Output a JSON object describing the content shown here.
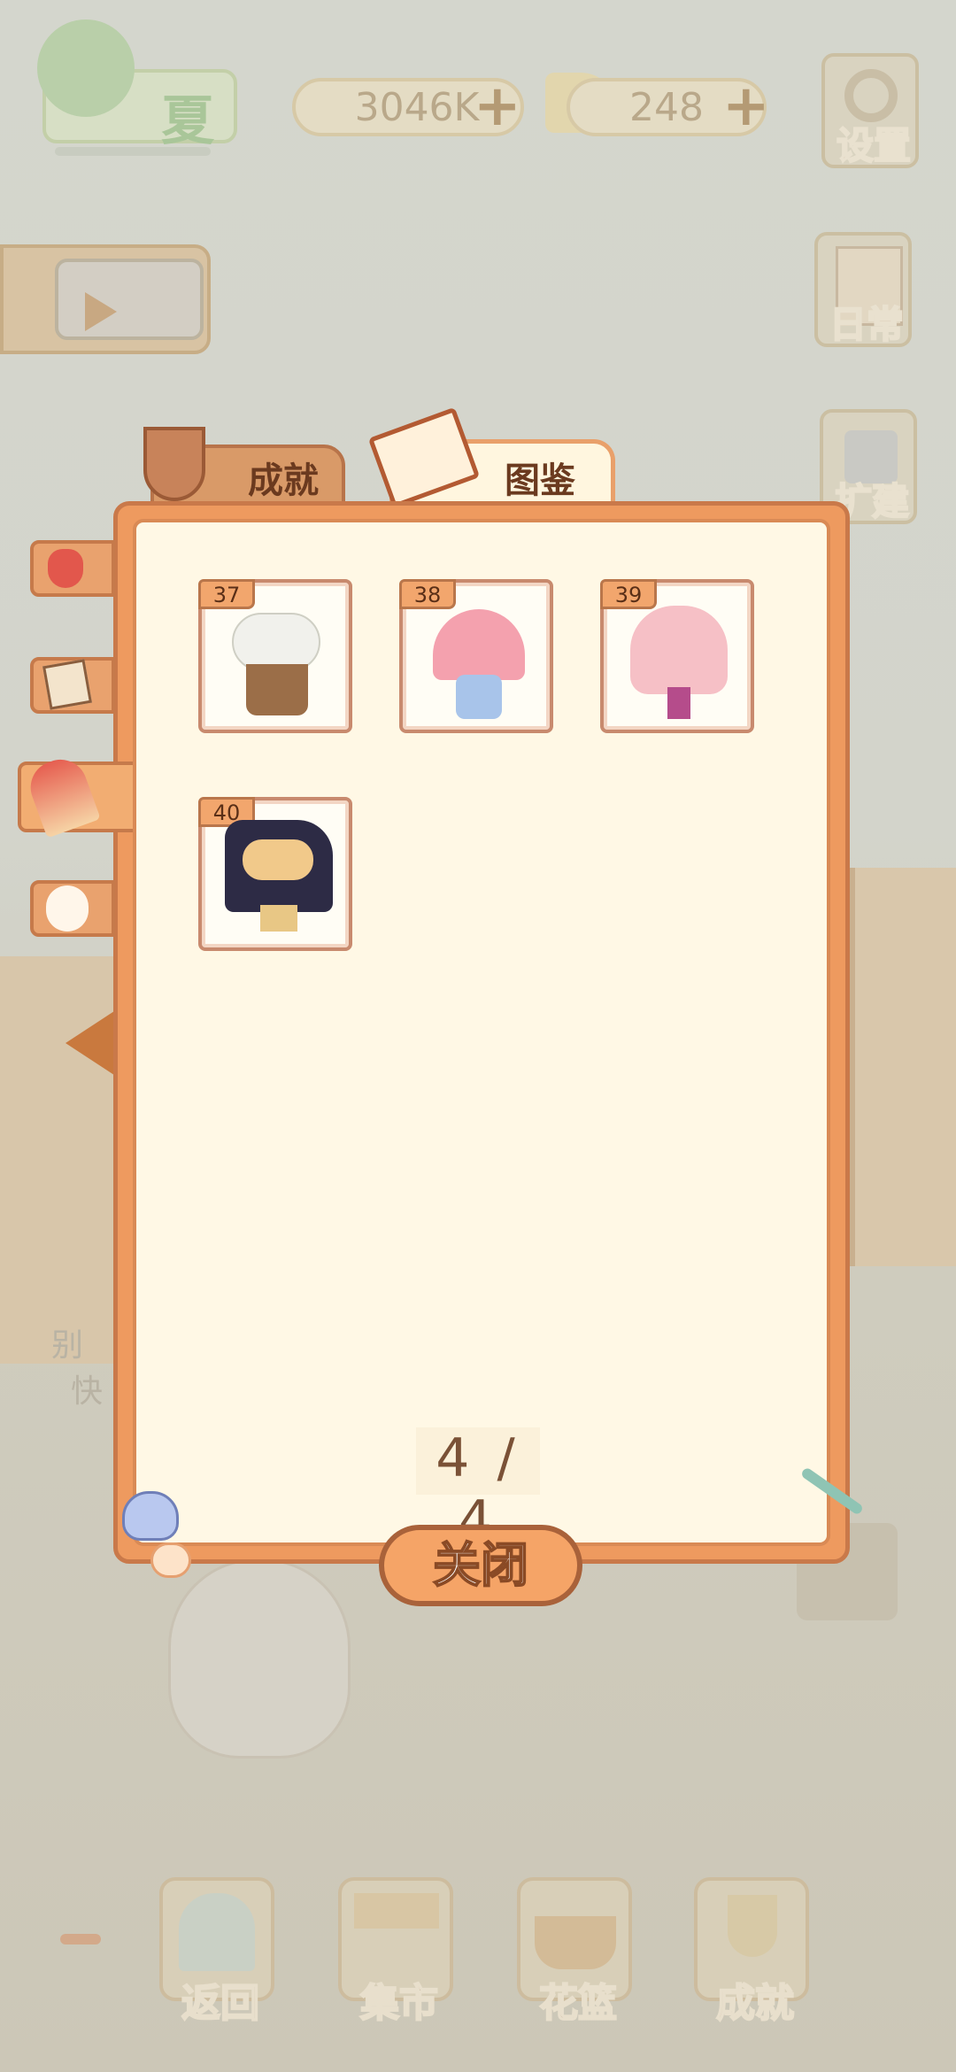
{
  "season": {
    "label": "夏"
  },
  "currency": {
    "fish": {
      "value": "3046K"
    },
    "cheese": {
      "value": "248"
    }
  },
  "right_menu": [
    {
      "label": "设置"
    },
    {
      "label": "日常"
    },
    {
      "label": "扩建"
    }
  ],
  "behind_text": {
    "line1": "别",
    "line2": "快"
  },
  "dialog": {
    "tabs": [
      {
        "label": "成就"
      },
      {
        "label": "图鉴",
        "active": true
      }
    ],
    "items": [
      {
        "number": "37",
        "name": "white-flower-basket"
      },
      {
        "number": "38",
        "name": "heart-bouquet"
      },
      {
        "number": "39",
        "name": "pink-bouquet"
      },
      {
        "number": "40",
        "name": "dark-wrapped-bouquet"
      }
    ],
    "page_counter": "4 / 4",
    "close_label": "关闭"
  },
  "bottom_nav": [
    {
      "label": "返回"
    },
    {
      "label": "集市"
    },
    {
      "label": "花篮"
    },
    {
      "label": "成就"
    }
  ],
  "colors": {
    "accent": "#ee9a5f",
    "panel": "#fff8e5",
    "border": "#c9794a"
  }
}
